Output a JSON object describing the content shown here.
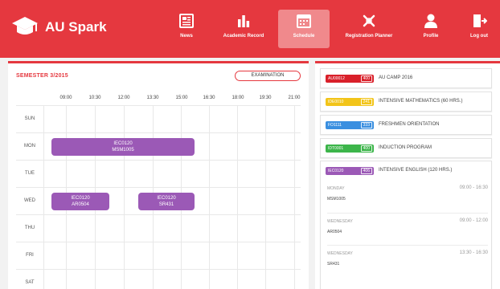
{
  "app": {
    "brand": "AU Spark"
  },
  "nav": {
    "items": [
      {
        "label": "News",
        "icon": "news-icon"
      },
      {
        "label": "Academic Record",
        "icon": "bar-chart-icon"
      },
      {
        "label": "Schedule",
        "icon": "calendar-icon",
        "active": true
      },
      {
        "label": "Registration Planner",
        "icon": "planner-icon"
      },
      {
        "label": "Profile",
        "icon": "user-icon"
      },
      {
        "label": "Log out",
        "icon": "logout-icon"
      }
    ]
  },
  "schedule": {
    "semester": "SEMESTER 3/2015",
    "exam_button": "EXAMINATION",
    "times": [
      "09:00",
      "10:30",
      "12:00",
      "13:30",
      "15:00",
      "16:30",
      "18:00",
      "19:30",
      "21:00"
    ],
    "days": [
      "SUN",
      "MON",
      "TUE",
      "WED",
      "THU",
      "FRI",
      "SAT"
    ],
    "events": [
      {
        "line1": "IEC0120",
        "line2": "MSM1005"
      },
      {
        "line1": "IEC0120",
        "line2": "AR0504"
      },
      {
        "line1": "IEC0120",
        "line2": "SR431"
      }
    ]
  },
  "courses": [
    {
      "code": "AU00012",
      "count": "400",
      "name": "AU CAMP 2016",
      "color": "#d9202a"
    },
    {
      "code": "IDE0010",
      "count": "241",
      "name": "INTENSIVE MATHEMATICS (60 HRS.)",
      "color": "#f2c419"
    },
    {
      "code": "FO1111",
      "count": "333",
      "name": "FRESHMEN ORIENTATION",
      "color": "#3a8fe0"
    },
    {
      "code": "IDT0001",
      "count": "400",
      "name": "INDUCTION PROGRAM",
      "color": "#3cb54a"
    }
  ],
  "detail": {
    "code": "IEC0120",
    "count": "406",
    "name": "INTENSIVE ENGLISH (120 HRS.)",
    "color": "#9b59b6",
    "sessions": [
      {
        "day": "MONDAY",
        "time": "09:00 - 16:30",
        "room": "MSM1005"
      },
      {
        "day": "WEDNESDAY",
        "time": "09:00 - 12:00",
        "room": "AR0504"
      },
      {
        "day": "WEDNESDAY",
        "time": "13:30 - 16:30",
        "room": "SR431"
      }
    ]
  }
}
